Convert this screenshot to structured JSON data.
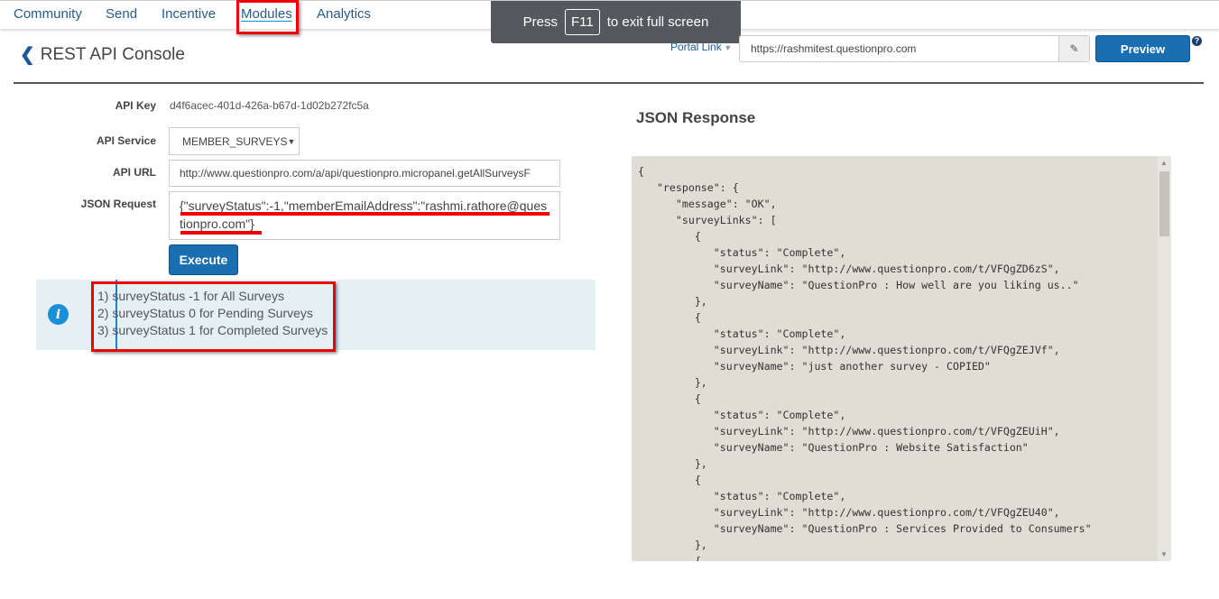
{
  "nav": {
    "items": [
      "Community",
      "Send",
      "Incentive",
      "Modules",
      "Analytics"
    ],
    "active": "Modules"
  },
  "toast": {
    "prefix": "Press",
    "key": "F11",
    "suffix": "to exit full screen"
  },
  "header": {
    "title": "REST API Console",
    "portal_label": "Portal Link",
    "portal_url": "https://rashmitest.questionpro.com",
    "preview_label": "Preview"
  },
  "form": {
    "api_key_label": "API Key",
    "api_key": "d4f6acec-401d-426a-b67d-1d02b272fc5a",
    "service_label": "API Service",
    "service": "MEMBER_SURVEYS",
    "url_label": "API URL",
    "url": "http://www.questionpro.com/a/api/questionpro.micropanel.getAllSurveysF",
    "request_label": "JSON Request",
    "request": "{\"surveyStatus\":-1,\"memberEmailAddress\":\"rashmi.rathore@questionpro.com\"}",
    "execute_label": "Execute"
  },
  "info": {
    "lines": [
      "1) surveyStatus -1 for All Surveys",
      "2) surveyStatus 0 for Pending Surveys",
      "3) surveyStatus 1 for Completed Surveys"
    ]
  },
  "response": {
    "title": "JSON Response",
    "lines": [
      "{",
      "   \"response\": {",
      "      \"message\": \"OK\",",
      "      \"surveyLinks\": [",
      "         {",
      "            \"status\": \"Complete\",",
      "            \"surveyLink\": \"http://www.questionpro.com/t/VFQgZD6zS\",",
      "            \"surveyName\": \"QuestionPro : How well are you liking us..\"",
      "         },",
      "         {",
      "            \"status\": \"Complete\",",
      "            \"surveyLink\": \"http://www.questionpro.com/t/VFQgZEJVf\",",
      "            \"surveyName\": \"just another survey - COPIED\"",
      "         },",
      "         {",
      "            \"status\": \"Complete\",",
      "            \"surveyLink\": \"http://www.questionpro.com/t/VFQgZEUiH\",",
      "            \"surveyName\": \"QuestionPro : Website Satisfaction\"",
      "         },",
      "         {",
      "            \"status\": \"Complete\",",
      "            \"surveyLink\": \"http://www.questionpro.com/t/VFQgZEU40\",",
      "            \"surveyName\": \"QuestionPro : Services Provided to Consumers\"",
      "         },",
      "         {"
    ]
  }
}
